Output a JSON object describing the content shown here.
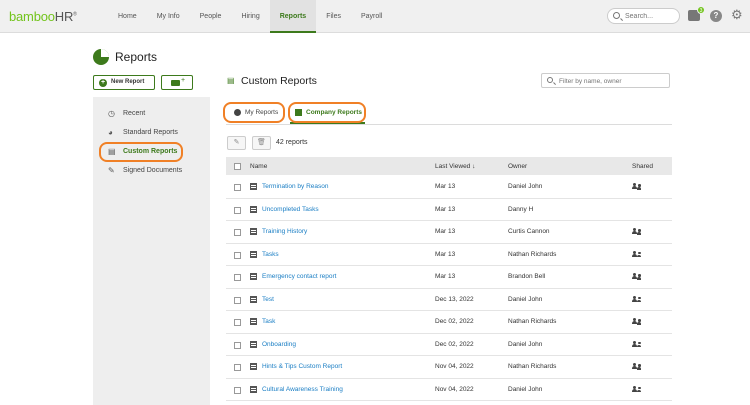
{
  "nav": {
    "logo_main": "bamboo",
    "logo_hr": "HR",
    "logo_mark": "®",
    "items": [
      {
        "label": "Home"
      },
      {
        "label": "My Info"
      },
      {
        "label": "People"
      },
      {
        "label": "Hiring"
      },
      {
        "label": "Reports",
        "active": true
      },
      {
        "label": "Files"
      },
      {
        "label": "Payroll"
      }
    ],
    "search_placeholder": "Search...",
    "inbox_badge": "3",
    "help_glyph": "?",
    "gear_glyph": "⚙"
  },
  "page": {
    "title": "Reports",
    "new_report_label": "New Report",
    "new_report_glyph": "+",
    "new_folder_glyph": "+"
  },
  "sidebar": {
    "items": [
      {
        "label": "Recent",
        "icon": "clock-icon"
      },
      {
        "label": "Standard Reports",
        "icon": "pie-chart-icon"
      },
      {
        "label": "Custom Reports",
        "icon": "custom-report-icon",
        "active": true
      },
      {
        "label": "Signed Documents",
        "icon": "signature-icon"
      }
    ]
  },
  "main": {
    "title": "Custom Reports",
    "filter_placeholder": "Filter by name, owner",
    "tabs": [
      {
        "label": "My Reports"
      },
      {
        "label": "Company Reports",
        "active": true
      }
    ],
    "report_count": "42 reports",
    "table": {
      "columns": {
        "name": "Name",
        "last_viewed": "Last Viewed ↓",
        "owner": "Owner",
        "shared": "Shared"
      },
      "rows": [
        {
          "name": "Termination by Reason",
          "last_viewed": "Mar 13",
          "owner": "Daniel John",
          "shared": true
        },
        {
          "name": "Uncompleted Tasks",
          "last_viewed": "Mar 13",
          "owner": "Danny H",
          "shared": false
        },
        {
          "name": "Training History",
          "last_viewed": "Mar 13",
          "owner": "Curtis Cannon",
          "shared": true
        },
        {
          "name": "Tasks",
          "last_viewed": "Mar 13",
          "owner": "Nathan Richards",
          "shared": true
        },
        {
          "name": "Emergency contact report",
          "last_viewed": "Mar 13",
          "owner": "Brandon Bell",
          "shared": true
        },
        {
          "name": "Test",
          "last_viewed": "Dec 13, 2022",
          "owner": "Daniel John",
          "shared": true
        },
        {
          "name": "Task",
          "last_viewed": "Dec 02, 2022",
          "owner": "Nathan Richards",
          "shared": true
        },
        {
          "name": "Onboarding",
          "last_viewed": "Dec 02, 2022",
          "owner": "Daniel John",
          "shared": true
        },
        {
          "name": "Hints & Tips Custom Report",
          "last_viewed": "Nov 04, 2022",
          "owner": "Nathan Richards",
          "shared": true
        },
        {
          "name": "Cultural Awareness Training",
          "last_viewed": "Nov 04, 2022",
          "owner": "Daniel John",
          "shared": true
        }
      ]
    }
  },
  "colors": {
    "brand_green": "#3d7a1c",
    "logo_green": "#73c41d",
    "highlight_orange": "#f08026",
    "link_blue": "#1a7ec4"
  }
}
